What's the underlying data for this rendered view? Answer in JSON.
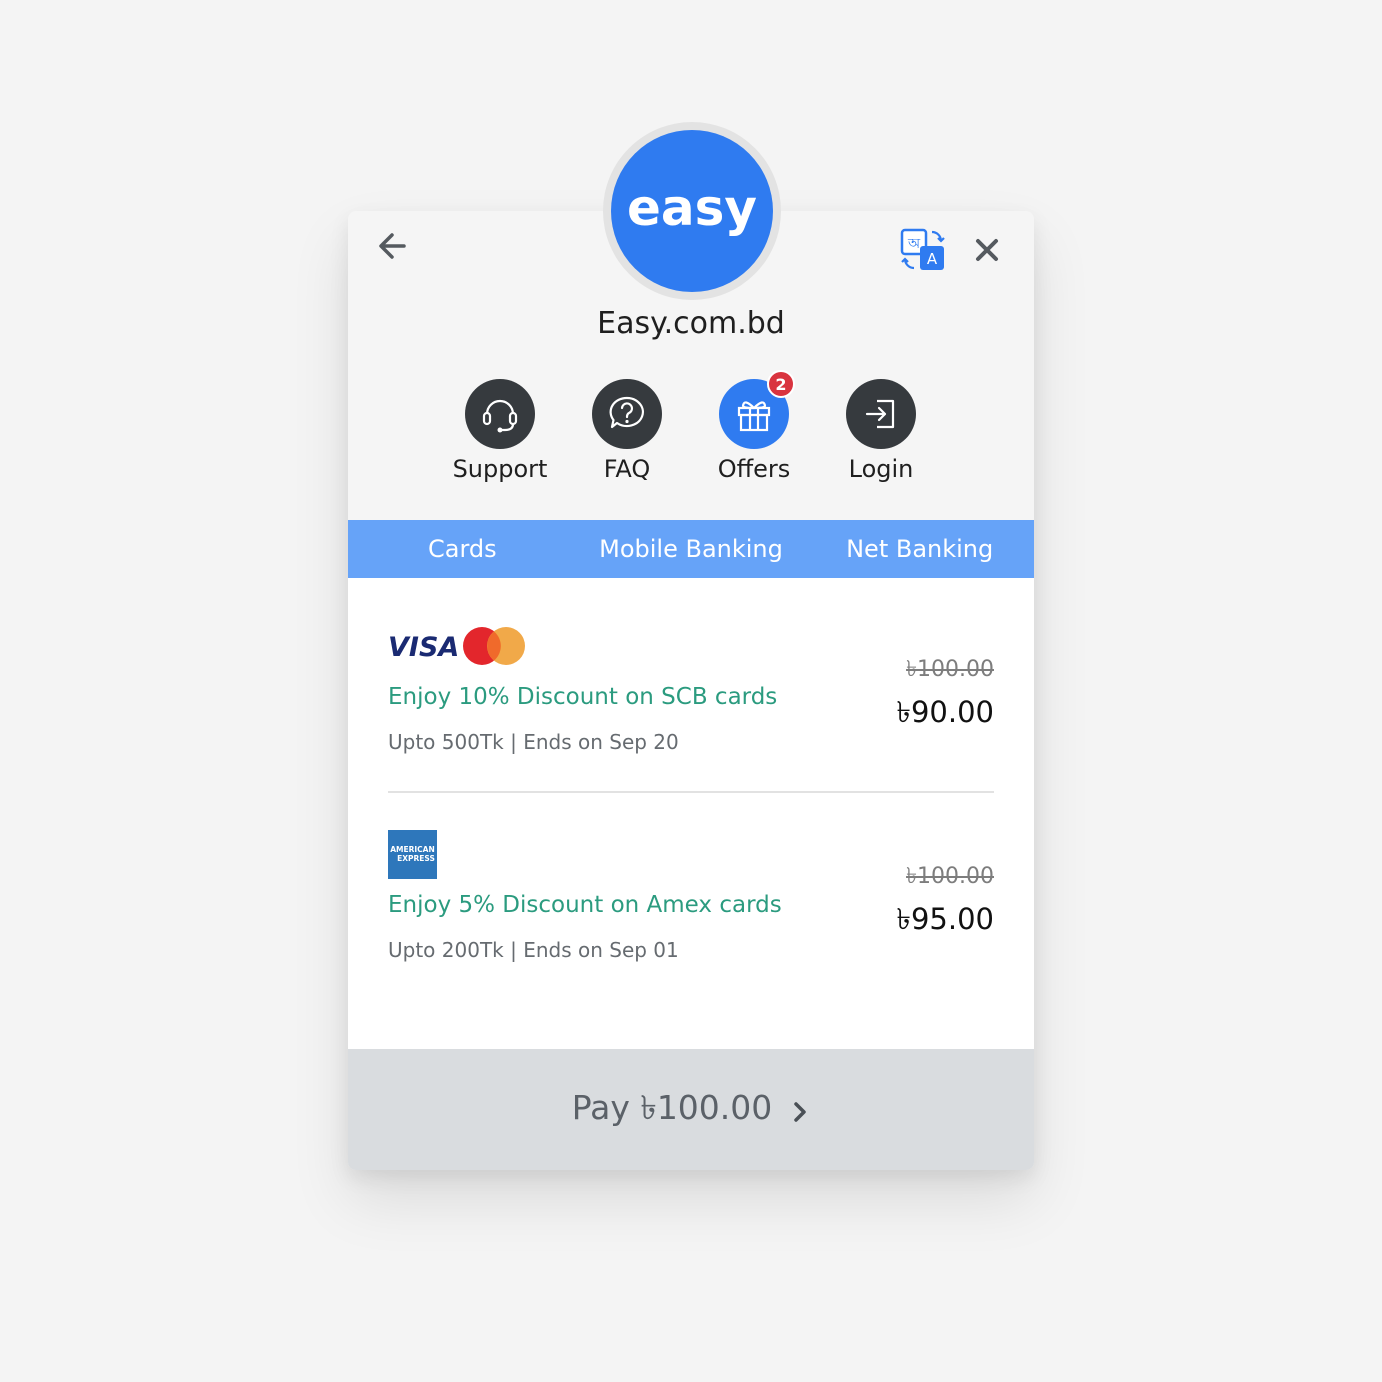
{
  "merchant": {
    "logo_text": "easy",
    "name": "Easy.com.bd",
    "brand_color": "#2f7bf0"
  },
  "header": {
    "back_icon": "arrow-left-icon",
    "translate_icon": "translate-icon",
    "close_icon": "close-icon"
  },
  "quick_actions": [
    {
      "label": "Support",
      "icon": "headset-icon"
    },
    {
      "label": "FAQ",
      "icon": "question-chat-icon"
    },
    {
      "label": "Offers",
      "icon": "gift-icon",
      "badge": "2",
      "active": true
    },
    {
      "label": "Login",
      "icon": "login-icon"
    }
  ],
  "tabs": [
    {
      "label": "Cards"
    },
    {
      "label": "Mobile Banking"
    },
    {
      "label": "Net Banking"
    }
  ],
  "offers": [
    {
      "logos": [
        "visa-logo",
        "mastercard-logo"
      ],
      "visa_text": "VISA",
      "title": "Enjoy 10% Discount on SCB cards",
      "subtitle": "Upto 500Tk | Ends on Sep 20",
      "old_price": "৳100.00",
      "new_price": "৳90.00"
    },
    {
      "logos": [
        "amex-logo"
      ],
      "amex_text_1": "AMERICAN",
      "amex_text_2": "EXPRESS",
      "title": "Enjoy 5% Discount on Amex cards",
      "subtitle": "Upto 200Tk | Ends on Sep 01",
      "old_price": "৳100.00",
      "new_price": "৳95.00"
    }
  ],
  "pay_button": {
    "label": "Pay ৳100.00",
    "icon": "chevron-right-icon"
  },
  "colors": {
    "tab_bar": "#66a3f8",
    "offer_title": "#2b9b7f",
    "badge": "#d9343f",
    "icon_circle": "#363a3e"
  }
}
